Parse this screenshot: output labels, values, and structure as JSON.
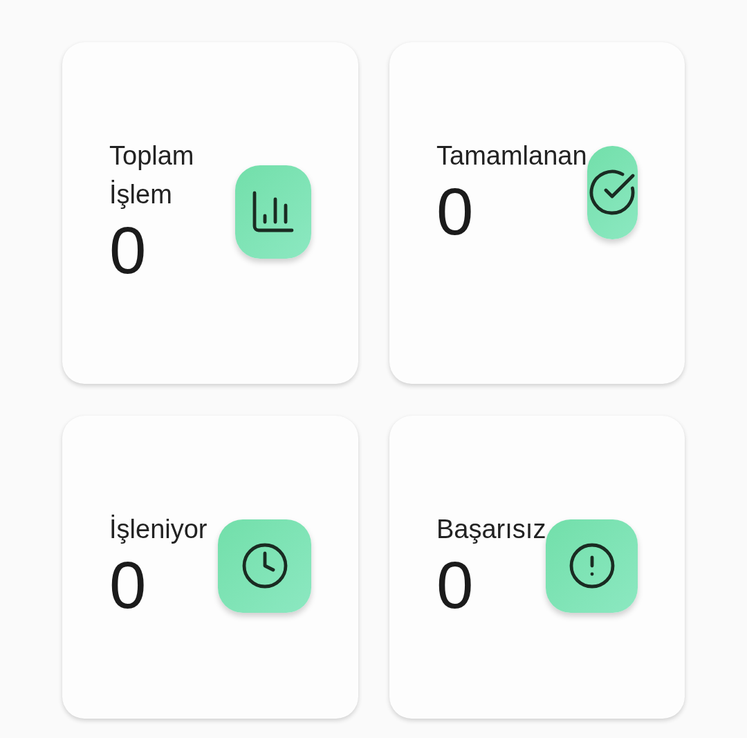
{
  "stats": [
    {
      "kind": "total",
      "label": "Toplam İşlem",
      "value": "0"
    },
    {
      "kind": "completed",
      "label": "Tamamlanan",
      "value": "0"
    },
    {
      "kind": "processing",
      "label": "İşleniyor",
      "value": "0"
    },
    {
      "kind": "failed",
      "label": "Başarısız",
      "value": "0"
    }
  ]
}
